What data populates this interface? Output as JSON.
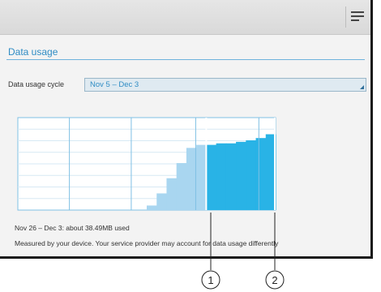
{
  "header": {
    "menu_icon": "overflow-menu-icon"
  },
  "section": {
    "title": "Data usage"
  },
  "cycle": {
    "label": "Data usage cycle",
    "value": "Nov 5 – Dec 3"
  },
  "usage": {
    "summary": "Nov 26 – Dec 3: about 38.49MB used",
    "note": "Measured by your device. Your service provider may account for data usage differently"
  },
  "callouts": [
    {
      "label": "1"
    },
    {
      "label": "2"
    }
  ],
  "colors": {
    "accent": "#2f8cc4",
    "usage_light": "#a9d6f0",
    "usage_selected": "#29b3e6",
    "grid": "#7fc0e4"
  },
  "chart_data": {
    "type": "area",
    "title": "",
    "xlabel": "",
    "ylabel": "",
    "series": [
      {
        "values": [
          0,
          0,
          0,
          0,
          0,
          0,
          0,
          0,
          0,
          0,
          0,
          0,
          0,
          0.06,
          0.22,
          0.42,
          0.62,
          0.82,
          0.86,
          0.86,
          0.88,
          0.88,
          0.9,
          0.92,
          0.95,
          1.0
        ]
      }
    ],
    "selected_range": "Nov 26 – Dec 3",
    "grid": true
  }
}
